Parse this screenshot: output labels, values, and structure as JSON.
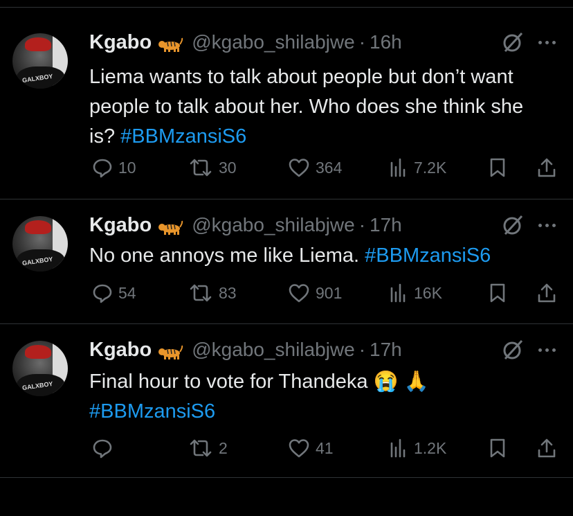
{
  "tweets": [
    {
      "name": "Kgabo",
      "handle": "@kgabo_shilabjwe",
      "separator": "·",
      "time": "16h",
      "text": "Liema wants to talk about people but don’t want people to talk about her. Who does she think she is?",
      "hashtag": "#BBMzansiS6",
      "replies": "10",
      "retweets": "30",
      "likes": "364",
      "views": "7.2K",
      "avatar_text": "GALXBOY"
    },
    {
      "name": "Kgabo",
      "handle": "@kgabo_shilabjwe",
      "separator": "·",
      "time": "17h",
      "text": "No one annoys me like Liema. ",
      "hashtag": "#BBMzansiS6",
      "replies": "54",
      "retweets": "83",
      "likes": "901",
      "views": "16K",
      "avatar_text": "GALXBOY"
    },
    {
      "name": "Kgabo",
      "handle": "@kgabo_shilabjwe",
      "separator": "·",
      "time": "17h",
      "text": "Final hour to vote for Thandeka 😭 🙏",
      "hashtag": "#BBMzansiS6",
      "replies": "",
      "retweets": "2",
      "likes": "41",
      "views": "1.2K",
      "avatar_text": "GALXBOY"
    }
  ],
  "icons": {
    "badge": "tiger-emoji-icon",
    "grok": "grok-slash-icon",
    "more": "more-dots-icon",
    "reply": "reply-icon",
    "retweet": "retweet-icon",
    "like": "heart-icon",
    "views": "views-bar-icon",
    "bookmark": "bookmark-icon",
    "share": "share-icon"
  },
  "colors": {
    "background": "#000000",
    "text": "#e7e9ea",
    "muted": "#71767b",
    "link": "#1d9bf0",
    "divider": "#2f3336"
  }
}
